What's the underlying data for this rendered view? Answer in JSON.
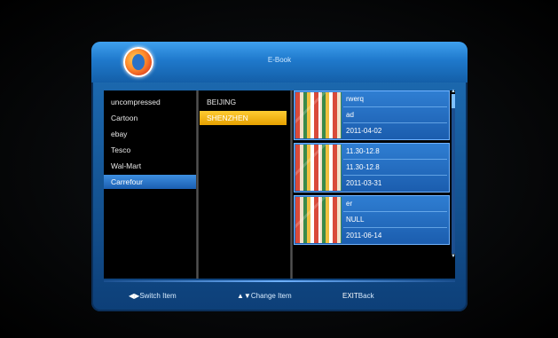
{
  "window": {
    "title": "E-Book"
  },
  "categories": {
    "items": [
      {
        "label": "uncompressed"
      },
      {
        "label": "Cartoon"
      },
      {
        "label": "ebay"
      },
      {
        "label": "Tesco"
      },
      {
        "label": "Wal-Mart"
      },
      {
        "label": "Carrefour"
      }
    ],
    "selected": "Carrefour"
  },
  "cities": {
    "items": [
      {
        "label": "BEIJING"
      },
      {
        "label": "SHENZHEN"
      }
    ],
    "selected": "SHENZHEN"
  },
  "catalogs": [
    {
      "name": "rwerq",
      "info": "ad",
      "date": "2011-04-02"
    },
    {
      "name": "11.30-12.8",
      "info": "11.30-12.8",
      "date": "2011-03-31"
    },
    {
      "name": "er",
      "info": "NULL",
      "date": "2011-06-14"
    }
  ],
  "footer": {
    "switch_icon": "◀▶",
    "switch_label": "Switch Item",
    "change_icon": "▲▼",
    "change_label": "Change Item",
    "exit_key": "EXIT",
    "exit_label": "Back"
  },
  "colors": {
    "accent": "#1f79cc",
    "selected_category": "#2f7fd8",
    "selected_city": "#f2b31a"
  }
}
